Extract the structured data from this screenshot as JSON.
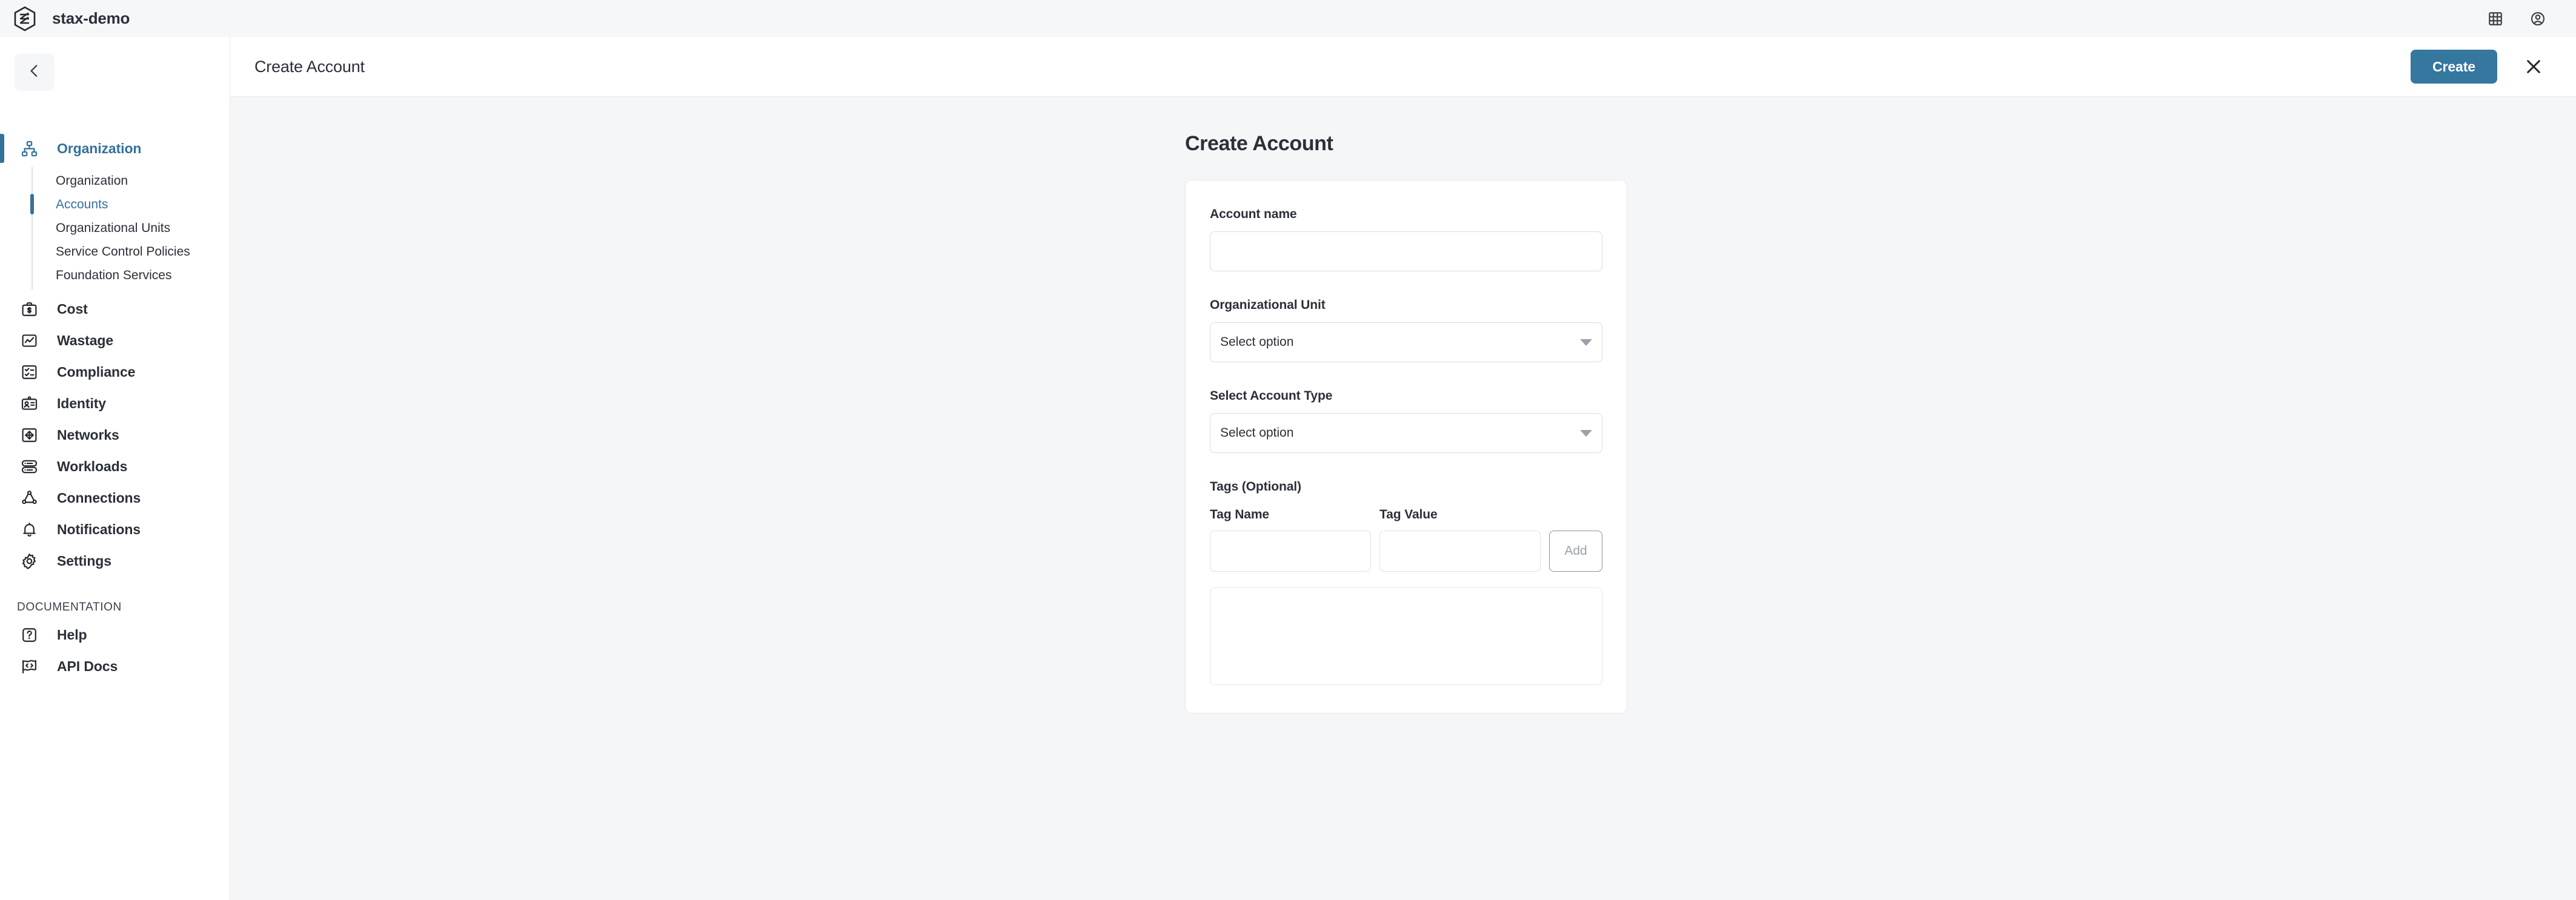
{
  "topbar": {
    "brand_name": "stax-demo",
    "logo_icon": "hexagon-s-logo-icon",
    "apps_icon": "grid-apps-icon",
    "account_icon": "user-avatar-icon"
  },
  "sidebar": {
    "collapse_icon": "chevron-left-icon",
    "groups": [
      {
        "label": "Organization",
        "icon": "org-chart-icon",
        "active": true,
        "subitems": [
          {
            "label": "Organization",
            "active": false
          },
          {
            "label": "Accounts",
            "active": true
          },
          {
            "label": "Organizational Units",
            "active": false
          },
          {
            "label": "Service Control Policies",
            "active": false
          },
          {
            "label": "Foundation Services",
            "active": false
          }
        ]
      }
    ],
    "items": [
      {
        "label": "Cost",
        "icon": "briefcase-dollar-icon"
      },
      {
        "label": "Wastage",
        "icon": "chart-line-box-icon"
      },
      {
        "label": "Compliance",
        "icon": "checklist-icon"
      },
      {
        "label": "Identity",
        "icon": "id-card-icon"
      },
      {
        "label": "Networks",
        "icon": "arrows-move-box-icon"
      },
      {
        "label": "Workloads",
        "icon": "server-stack-icon"
      },
      {
        "label": "Connections",
        "icon": "nodes-connection-icon"
      },
      {
        "label": "Notifications",
        "icon": "bell-icon"
      },
      {
        "label": "Settings",
        "icon": "gear-icon"
      }
    ],
    "documentation_title": "DOCUMENTATION",
    "documentation_items": [
      {
        "label": "Help",
        "icon": "question-box-icon"
      },
      {
        "label": "API Docs",
        "icon": "code-flag-icon"
      }
    ]
  },
  "page_header": {
    "title": "Create Account",
    "create_label": "Create",
    "close_icon": "close-x-icon"
  },
  "form": {
    "title": "Create Account",
    "account_name": {
      "label": "Account name",
      "value": "",
      "placeholder": ""
    },
    "organizational_unit": {
      "label": "Organizational Unit",
      "value": "Select option",
      "caret_icon": "chevron-down-icon"
    },
    "account_type": {
      "label": "Select Account Type",
      "value": "Select option",
      "caret_icon": "chevron-down-icon"
    },
    "tags": {
      "title": "Tags (Optional)",
      "name_label": "Tag Name",
      "value_label": "Tag Value",
      "name_value": "",
      "name_placeholder": "",
      "value_value": "",
      "value_placeholder": "",
      "add_label": "Add",
      "entries": []
    }
  },
  "colors": {
    "accent": "#35779f",
    "page_bg": "#f5f6f8",
    "panel_bg": "#ffffff",
    "text": "#2b2f38"
  }
}
